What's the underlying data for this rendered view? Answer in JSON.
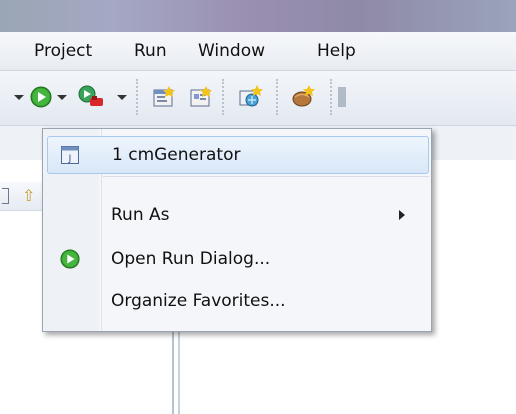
{
  "menubar": {
    "items": [
      {
        "label": "Project"
      },
      {
        "label": "Run"
      },
      {
        "label": "Window"
      },
      {
        "label": "Help"
      }
    ]
  },
  "toolbar": {
    "icons": [
      "run-icon",
      "external-tools-icon",
      "new-project-icon",
      "new-file-icon",
      "new-wizard-icon",
      "new-server-icon"
    ]
  },
  "dropdown": {
    "items": [
      {
        "label": "1 cmGenerator",
        "icon": "java-app-icon",
        "selected": true
      },
      {
        "label": "Run As",
        "has_submenu": true
      },
      {
        "label": "Open Run Dialog...",
        "icon": "run-icon"
      },
      {
        "label": "Organize Favorites..."
      }
    ]
  },
  "colors": {
    "run_green": "#2e9d2a",
    "selection_border": "#a8c8ec",
    "menu_background": "#f4f6f9"
  }
}
